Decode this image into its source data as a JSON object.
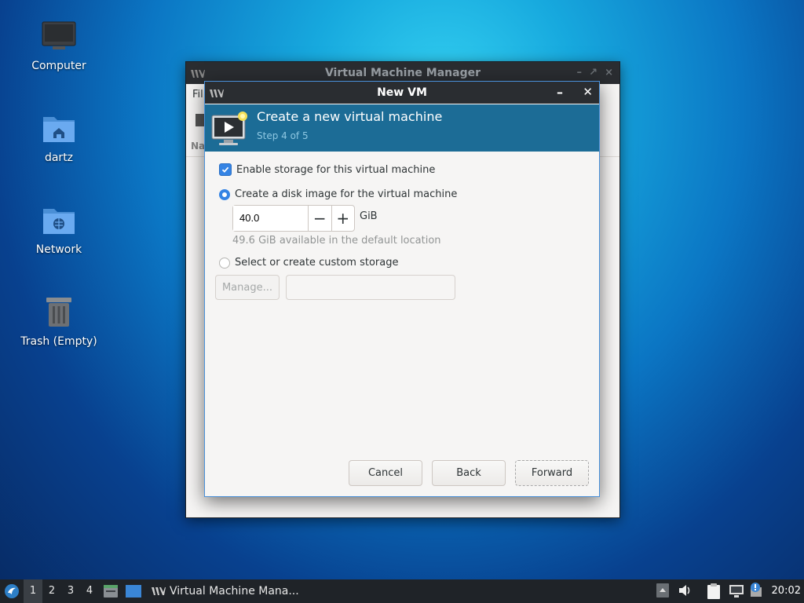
{
  "desktop": {
    "icons": [
      {
        "label": "Computer",
        "icon": "computer-icon"
      },
      {
        "label": "dartz",
        "icon": "home-folder-icon"
      },
      {
        "label": "Network",
        "icon": "network-folder-icon"
      },
      {
        "label": "Trash (Empty)",
        "icon": "trash-icon"
      }
    ]
  },
  "background_window": {
    "title": "Virtual Machine Manager",
    "menu_partial": "Fil",
    "column_partial": "Na",
    "controls": [
      "–",
      "↗",
      "×"
    ]
  },
  "dialog": {
    "title": "New VM",
    "minimize": "–",
    "close": "✕",
    "header": {
      "title": "Create a new virtual machine",
      "step": "Step 4 of 5"
    },
    "enable_storage": {
      "label": "Enable storage for this virtual machine",
      "checked": true
    },
    "create_disk": {
      "label": "Create a disk image for the virtual machine",
      "selected": true
    },
    "disk_size": {
      "value": "40.0",
      "unit": "GiB",
      "minus": "−",
      "plus": "+"
    },
    "available_hint": "49.6 GiB available in the default location",
    "custom_storage": {
      "label": "Select or create custom storage",
      "selected": false
    },
    "manage_button": "Manage...",
    "storage_path": "",
    "buttons": {
      "cancel": "Cancel",
      "back": "Back",
      "forward": "Forward"
    }
  },
  "taskbar": {
    "workspaces": [
      "1",
      "2",
      "3",
      "4"
    ],
    "active_workspace": "1",
    "task_label": "Virtual Machine Mana...",
    "clock": "20:02"
  },
  "colors": {
    "accent": "#3584e4",
    "header": "#1c6c96",
    "titlebar": "#2a2d31"
  }
}
